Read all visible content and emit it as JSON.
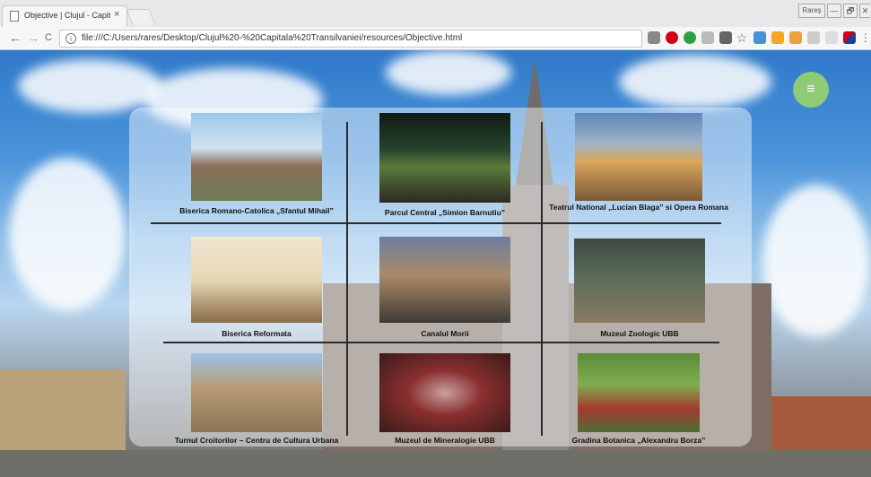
{
  "browser": {
    "tab_title": "Objective | Clujul - Capita",
    "tab_close": "×",
    "user_badge": "Rareș",
    "minimize": "—",
    "maximize": "🗗",
    "close": "✕",
    "back": "←",
    "forward": "→",
    "reload": "C",
    "info": "i",
    "url": "file:///C:/Users/rares/Desktop/Clujul%20-%20Capitala%20Transilvaniei/resources/Objective.html",
    "star": "☆"
  },
  "page": {
    "menu_icon": "≡",
    "attractions": [
      {
        "caption": "Biserica Romano-Catolica „Sfantul Mihail”",
        "image": "church-photo"
      },
      {
        "caption": "Parcul Central „Simion Barnutiu”",
        "image": "park-photo"
      },
      {
        "caption": "Teatrul National „Lucian Blaga” si Opera Romana",
        "image": "theatre-photo"
      },
      {
        "caption": "Biserica Reformata",
        "image": "church-interior-photo"
      },
      {
        "caption": "Canalul Morii",
        "image": "canal-photo"
      },
      {
        "caption": "Muzeul Zoologic UBB",
        "image": "museum-photo"
      },
      {
        "caption": "Turnul Croitorilor – Centru de Cultura Urbana",
        "image": "tower-photo"
      },
      {
        "caption": "Muzeul de Mineralogie UBB",
        "image": "mineral-photo"
      },
      {
        "caption": "Gradina Botanica „Alexandru Borza”",
        "image": "garden-photo"
      }
    ]
  },
  "colors": {
    "menu_button": "#8fca77",
    "divider": "#2b2b2b"
  }
}
